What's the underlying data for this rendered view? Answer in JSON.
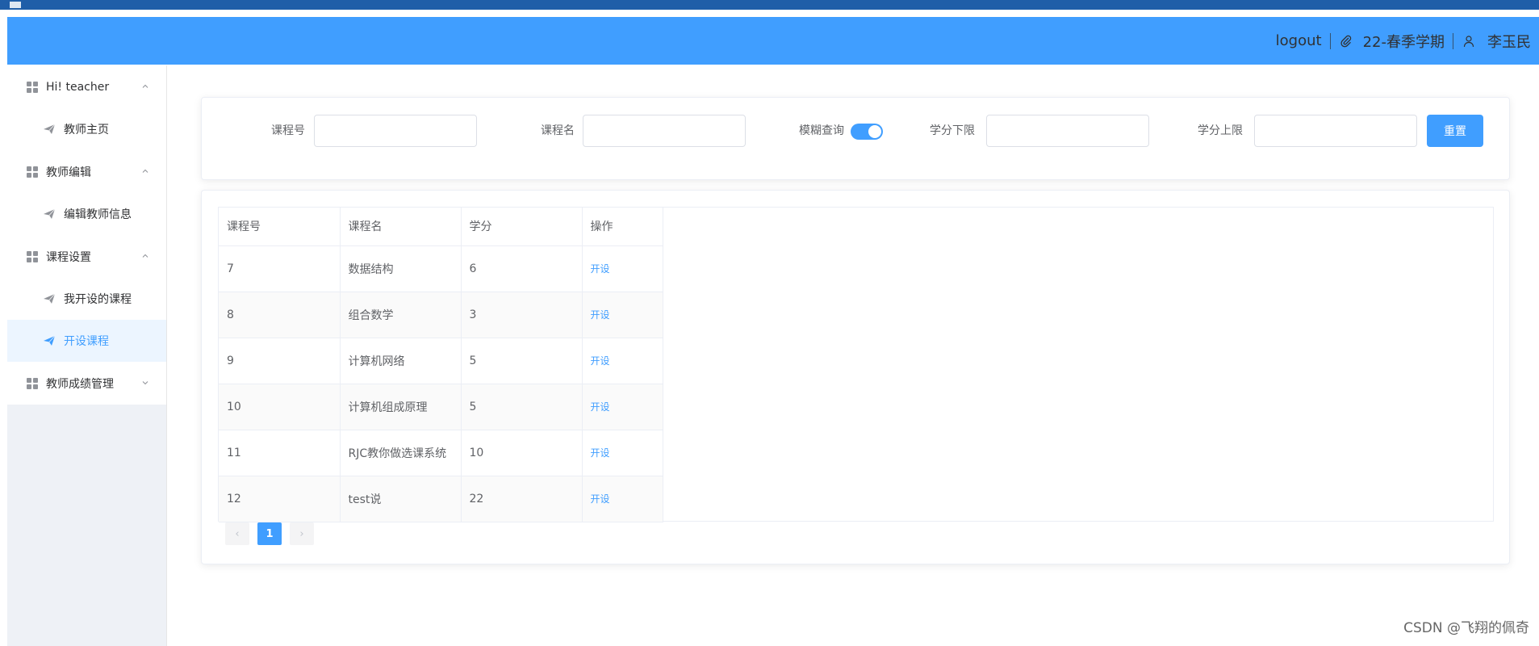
{
  "header": {
    "logout_label": "logout",
    "term": "22-春季学期",
    "username": "李玉民",
    "icons": {
      "clip": "paperclip-icon",
      "user": "user-icon"
    }
  },
  "sidebar": {
    "groups": [
      {
        "label": "Hi! teacher",
        "expanded": true,
        "items": [
          {
            "label": "教师主页"
          }
        ]
      },
      {
        "label": "教师编辑",
        "expanded": true,
        "items": [
          {
            "label": "编辑教师信息"
          }
        ]
      },
      {
        "label": "课程设置",
        "expanded": true,
        "items": [
          {
            "label": "我开设的课程"
          },
          {
            "label": "开设课程",
            "active": true
          }
        ]
      },
      {
        "label": "教师成绩管理",
        "expanded": false,
        "items": []
      }
    ]
  },
  "search": {
    "course_no_label": "课程号",
    "course_name_label": "课程名",
    "fuzzy_label": "模糊查询",
    "fuzzy_on": true,
    "credit_min_label": "学分下限",
    "credit_max_label": "学分上限",
    "reset_label": "重置"
  },
  "table": {
    "headers": [
      "课程号",
      "课程名",
      "学分",
      "操作"
    ],
    "rows": [
      {
        "id": "7",
        "name": "数据结构",
        "credit": "6",
        "action": "开设"
      },
      {
        "id": "8",
        "name": "组合数学",
        "credit": "3",
        "action": "开设"
      },
      {
        "id": "9",
        "name": "计算机网络",
        "credit": "5",
        "action": "开设"
      },
      {
        "id": "10",
        "name": "计算机组成原理",
        "credit": "5",
        "action": "开设"
      },
      {
        "id": "11",
        "name": "RJC教你做选课系统",
        "credit": "10",
        "action": "开设"
      },
      {
        "id": "12",
        "name": "test说",
        "credit": "22",
        "action": "开设"
      }
    ]
  },
  "pagination": {
    "prev": "‹",
    "current": "1",
    "next": "›"
  },
  "watermark": "CSDN @飞翔的佩奇",
  "colors": {
    "primary": "#409eff",
    "topbar": "#1f5ea8",
    "sidebar_bg": "#eef1f6"
  }
}
